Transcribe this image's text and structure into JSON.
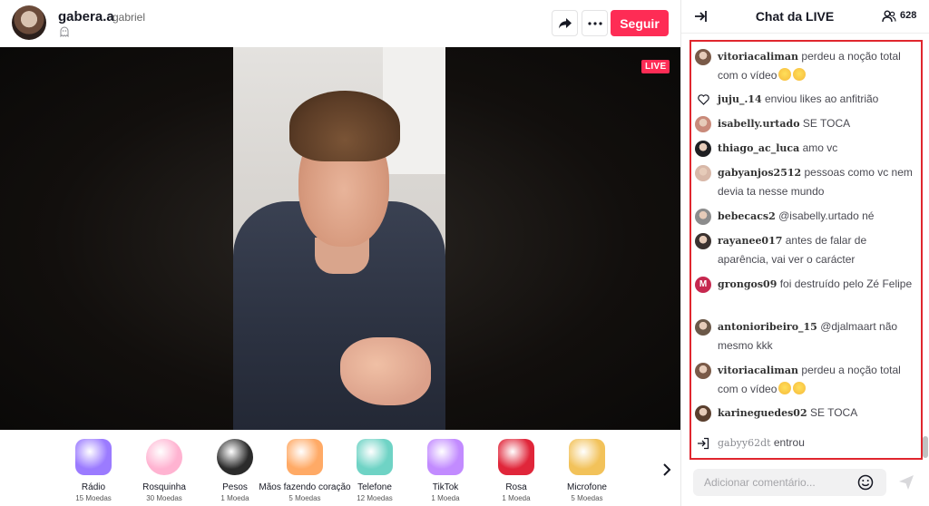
{
  "host": {
    "name": "gabera.a",
    "nickname": "gabriel"
  },
  "toolbar": {
    "follow_label": "Seguir"
  },
  "stream": {
    "live_label": "LIVE"
  },
  "gifts": [
    {
      "name": "Rádio",
      "price": "15 Moedas",
      "icon": "radio-icon",
      "color": "#9b7bff"
    },
    {
      "name": "Rosquinha",
      "price": "30 Moedas",
      "icon": "donut-icon",
      "color": "#ffb3d1"
    },
    {
      "name": "Pesos",
      "price": "1 Moeda",
      "icon": "dumbbell-icon",
      "color": "#2b2b2b"
    },
    {
      "name": "Mãos fazendo coração",
      "price": "5 Moedas",
      "icon": "finger-heart-icon",
      "color": "#ffaa66"
    },
    {
      "name": "Telefone",
      "price": "12 Moedas",
      "icon": "phone-icon",
      "color": "#6fd3c5"
    },
    {
      "name": "TikTok",
      "price": "1 Moeda",
      "icon": "tiktok-icon",
      "color": "#c28bff"
    },
    {
      "name": "Rosa",
      "price": "1 Moeda",
      "icon": "rose-icon",
      "color": "#e0263a"
    },
    {
      "name": "Microfone",
      "price": "5 Moedas",
      "icon": "microphone-icon",
      "color": "#f2c25a"
    }
  ],
  "chat": {
    "title": "Chat da LIVE",
    "viewers": "628",
    "messages": [
      {
        "user": "vitoriacaliman",
        "text": "perdeu a noção total com o vídeo",
        "emoji": 2,
        "avatar": "#7a5a48"
      },
      {
        "user": "juju_.14",
        "text": "enviou likes ao anfitrião",
        "emoji": 0,
        "avatar": "heart"
      },
      {
        "user": "isabelly.urtado",
        "text": "SE TOCA",
        "emoji": 0,
        "avatar": "#c98a7a"
      },
      {
        "user": "thiago_ac_luca",
        "text": "amo vc",
        "emoji": 0,
        "avatar": "#1f1f22"
      },
      {
        "user": "gabyanjos2512",
        "text": "pessoas como vc nem devia ta nesse mundo",
        "emoji": 0,
        "avatar": "#d8b8a8"
      },
      {
        "user": "bebecacs2",
        "text": "@isabelly.urtado né",
        "emoji": 0,
        "avatar": "#8c8c8c"
      },
      {
        "user": "rayanee017",
        "text": "antes de falar de aparência, vai ver o carácter",
        "emoji": 0,
        "avatar": "#3b3230"
      },
      {
        "user": "grongos09",
        "text": "foi destruído pelo Zé Felipe",
        "emoji": 0,
        "avatar": "M"
      },
      {
        "user": "antonioribeiro_15",
        "text": "@djalmaart não mesmo kkk",
        "emoji": 0,
        "avatar": "#6b5848"
      },
      {
        "user": "vitoriacaliman",
        "text": "perdeu a noção total com o vídeo",
        "emoji": 2,
        "avatar": "#7a5a48"
      },
      {
        "user": "karineguedes02",
        "text": "SE TOCA",
        "emoji": 0,
        "avatar": "#5a3f2e"
      },
      {
        "user": "gabyy62dt",
        "text": "entrou",
        "emoji": 0,
        "avatar": "join"
      }
    ],
    "comment_placeholder": "Adicionar comentário..."
  }
}
